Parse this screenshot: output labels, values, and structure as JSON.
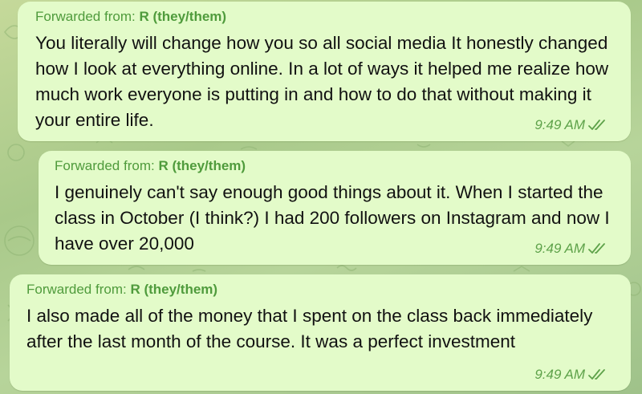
{
  "colors": {
    "bubble_background": "#e3fbc9",
    "forwarded_text": "#4f9b3c",
    "meta_text": "#5ea24a",
    "message_text": "#111111"
  },
  "messages": [
    {
      "forwarded_prefix": "Forwarded from: ",
      "forwarded_name": "R (they/them)",
      "text": "You literally will change how you so all social media It honestly changed how I look at everything online. In a lot of ways it helped me realize how much work everyone is putting in and how to do that without making it your entire life.",
      "time": "9:49 AM",
      "status_icon": "double-check-icon"
    },
    {
      "forwarded_prefix": "Forwarded from: ",
      "forwarded_name": "R (they/them)",
      "text": "I genuinely can't say enough good things about it. When I started the class in October (I think?) I had 200 followers on Instagram and now I have over 20,000",
      "time": "9:49 AM",
      "status_icon": "double-check-icon"
    },
    {
      "forwarded_prefix": "Forwarded from: ",
      "forwarded_name": "R (they/them)",
      "text": "I also made all of the money that I spent on the class back immediately after the last month of the course. It was a perfect investment",
      "time": "9:49 AM",
      "status_icon": "double-check-icon"
    }
  ]
}
